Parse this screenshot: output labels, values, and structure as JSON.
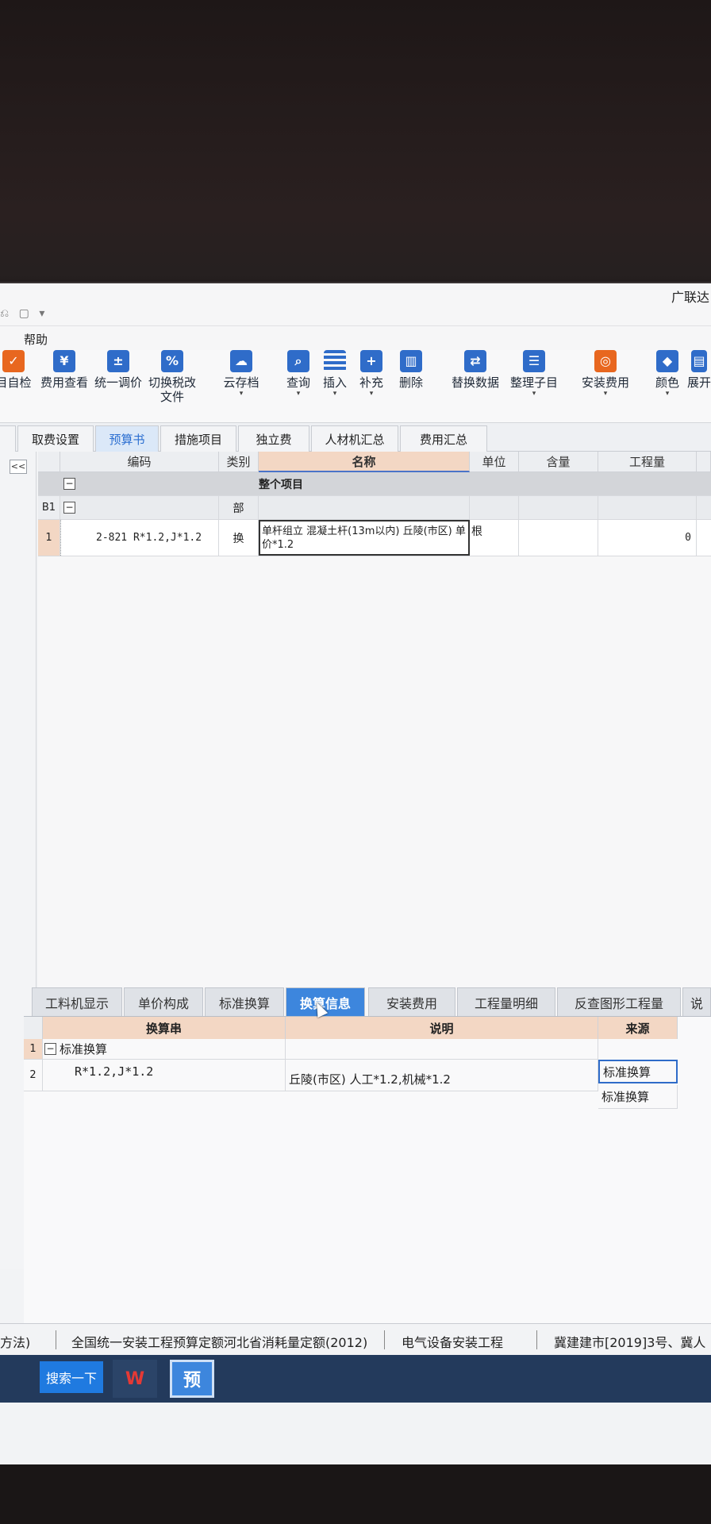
{
  "app": {
    "title": "广联达",
    "quick_access": "⎌ ▢ ▾",
    "menu": "帮助"
  },
  "ribbon": [
    {
      "label": "目自检",
      "icon": "check-icon",
      "glyph": "✓"
    },
    {
      "label": "费用查看",
      "icon": "cost-icon",
      "glyph": "¥"
    },
    {
      "label": "统一调价",
      "icon": "price-adjust-icon",
      "glyph": "±"
    },
    {
      "label": "切换税改",
      "label2": "文件",
      "icon": "tax-icon",
      "glyph": "%"
    },
    {
      "label": "云存档",
      "icon": "cloud-icon",
      "glyph": "☁"
    },
    {
      "label": "查询",
      "icon": "query-icon",
      "glyph": "⌕"
    },
    {
      "label": "插入",
      "icon": "insert-icon",
      "glyph": "≡"
    },
    {
      "label": "补充",
      "icon": "supplement-icon",
      "glyph": "+"
    },
    {
      "label": "删除",
      "icon": "delete-icon",
      "glyph": "🗑"
    },
    {
      "label": "替换数据",
      "icon": "replace-icon",
      "glyph": "⇄"
    },
    {
      "label": "整理子目",
      "icon": "organize-icon",
      "glyph": "☰"
    },
    {
      "label": "安装费用",
      "icon": "install-fee-icon",
      "glyph": "◎"
    },
    {
      "label": "颜色",
      "icon": "color-icon",
      "glyph": "◆"
    },
    {
      "label": "展开",
      "icon": "expand-icon",
      "glyph": "▤"
    }
  ],
  "module_tabs": [
    "取费设置",
    "预算书",
    "措施项目",
    "独立费",
    "人材机汇总",
    "费用汇总"
  ],
  "main_grid": {
    "collapse_label": "<<",
    "headers": [
      "编码",
      "类别",
      "名称",
      "单位",
      "含量",
      "工程量"
    ],
    "group_row": {
      "toggle": "−",
      "name": "整个项目"
    },
    "section_row": {
      "rownum": "B1",
      "toggle": "−",
      "type": "部"
    },
    "item_row": {
      "rownum": "1",
      "code": "2-821 R*1.2,J*1.2",
      "type": "换",
      "name": "单杆组立 混凝土杆(13m以内) 丘陵(市区) 单价*1.2",
      "unit": "根",
      "qty": "0"
    }
  },
  "lower_tabs": [
    "工料机显示",
    "单价构成",
    "标准换算",
    "换算信息",
    "安装费用",
    "工程量明细",
    "反查图形工程量",
    "说"
  ],
  "lower_grid": {
    "headers": [
      "换算串",
      "说明",
      "来源"
    ],
    "rows": [
      {
        "rownum": "1",
        "toggle": "−",
        "string": "标准换算",
        "desc": "",
        "source": "标准换算"
      },
      {
        "rownum": "2",
        "string": "R*1.2,J*1.2",
        "desc": "丘陵(市区) 人工*1.2,机械*1.2",
        "source": "标准换算"
      }
    ]
  },
  "statusbar": {
    "item1": "方法)",
    "item2": "全国统一安装工程预算定额河北省消耗量定额(2012)",
    "item3": "电气设备安装工程",
    "item4": "冀建建市[2019]3号、冀人"
  },
  "taskbar": {
    "search": "搜索一下",
    "app_wps": "W",
    "app_yu": "预"
  }
}
